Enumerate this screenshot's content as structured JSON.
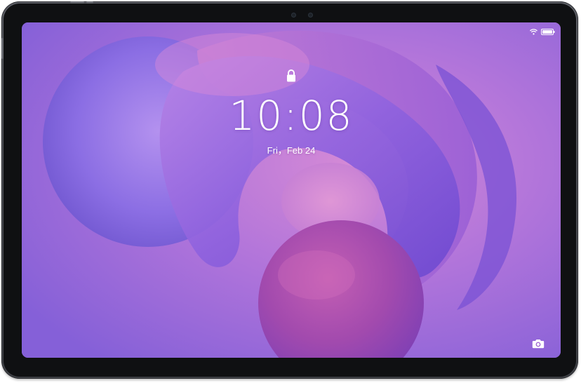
{
  "lockscreen": {
    "time": "10:08",
    "date": "Fri，Feb 24"
  },
  "icons": {
    "lock": "lock-icon",
    "wifi": "wifi-icon",
    "battery": "battery-icon",
    "camera": "camera-icon"
  },
  "colors": {
    "frame": "#55575d",
    "bezel": "#0f1012",
    "wallpaper_primary": "#a66fd8",
    "wallpaper_accent": "#c67ad2",
    "text": "#ffffff"
  }
}
